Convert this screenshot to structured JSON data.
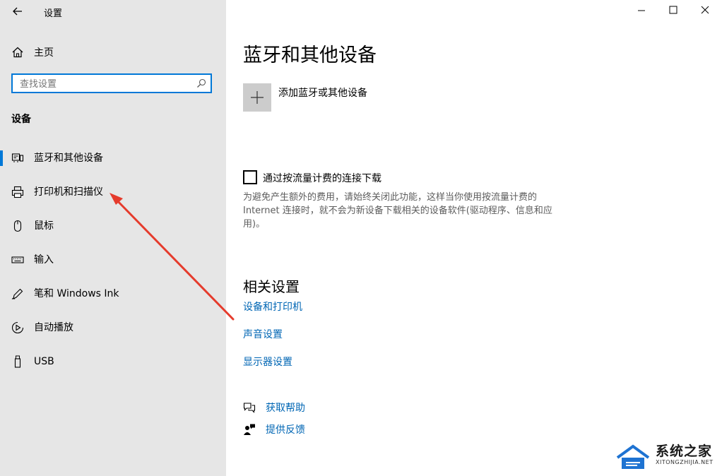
{
  "window": {
    "title": "设置",
    "controls": {
      "minimize": "minimize-icon",
      "maximize": "maximize-icon",
      "close": "close-icon"
    }
  },
  "sidebar": {
    "home_label": "主页",
    "search": {
      "placeholder": "查找设置",
      "value": ""
    },
    "section_title": "设备",
    "items": [
      {
        "label": "蓝牙和其他设备",
        "icon": "bluetooth-devices-icon",
        "selected": true
      },
      {
        "label": "打印机和扫描仪",
        "icon": "printer-icon",
        "selected": false
      },
      {
        "label": "鼠标",
        "icon": "mouse-icon",
        "selected": false
      },
      {
        "label": "输入",
        "icon": "keyboard-icon",
        "selected": false
      },
      {
        "label": "笔和 Windows Ink",
        "icon": "pen-icon",
        "selected": false
      },
      {
        "label": "自动播放",
        "icon": "autoplay-icon",
        "selected": false
      },
      {
        "label": "USB",
        "icon": "usb-icon",
        "selected": false
      }
    ]
  },
  "main": {
    "title": "蓝牙和其他设备",
    "add_device_label": "添加蓝牙或其他设备",
    "metered": {
      "label": "通过按流量计费的连接下载",
      "checked": false,
      "description": "为避免产生额外的费用，请始终关闭此功能，这样当你使用按流量计费的Internet 连接时，就不会为新设备下载相关的设备软件(驱动程序、信息和应用)。"
    },
    "related": {
      "title": "相关设置",
      "links": [
        "设备和打印机",
        "声音设置",
        "显示器设置"
      ]
    },
    "help": {
      "get_help": "获取帮助",
      "feedback": "提供反馈"
    }
  },
  "colors": {
    "accent": "#0078d7",
    "link": "#0066b4",
    "sidebar_bg": "#e6e6e6",
    "annotation": "#e53b2c"
  },
  "watermark": {
    "name": "系统之家",
    "url": "XITONGZHIJIA.NET"
  }
}
